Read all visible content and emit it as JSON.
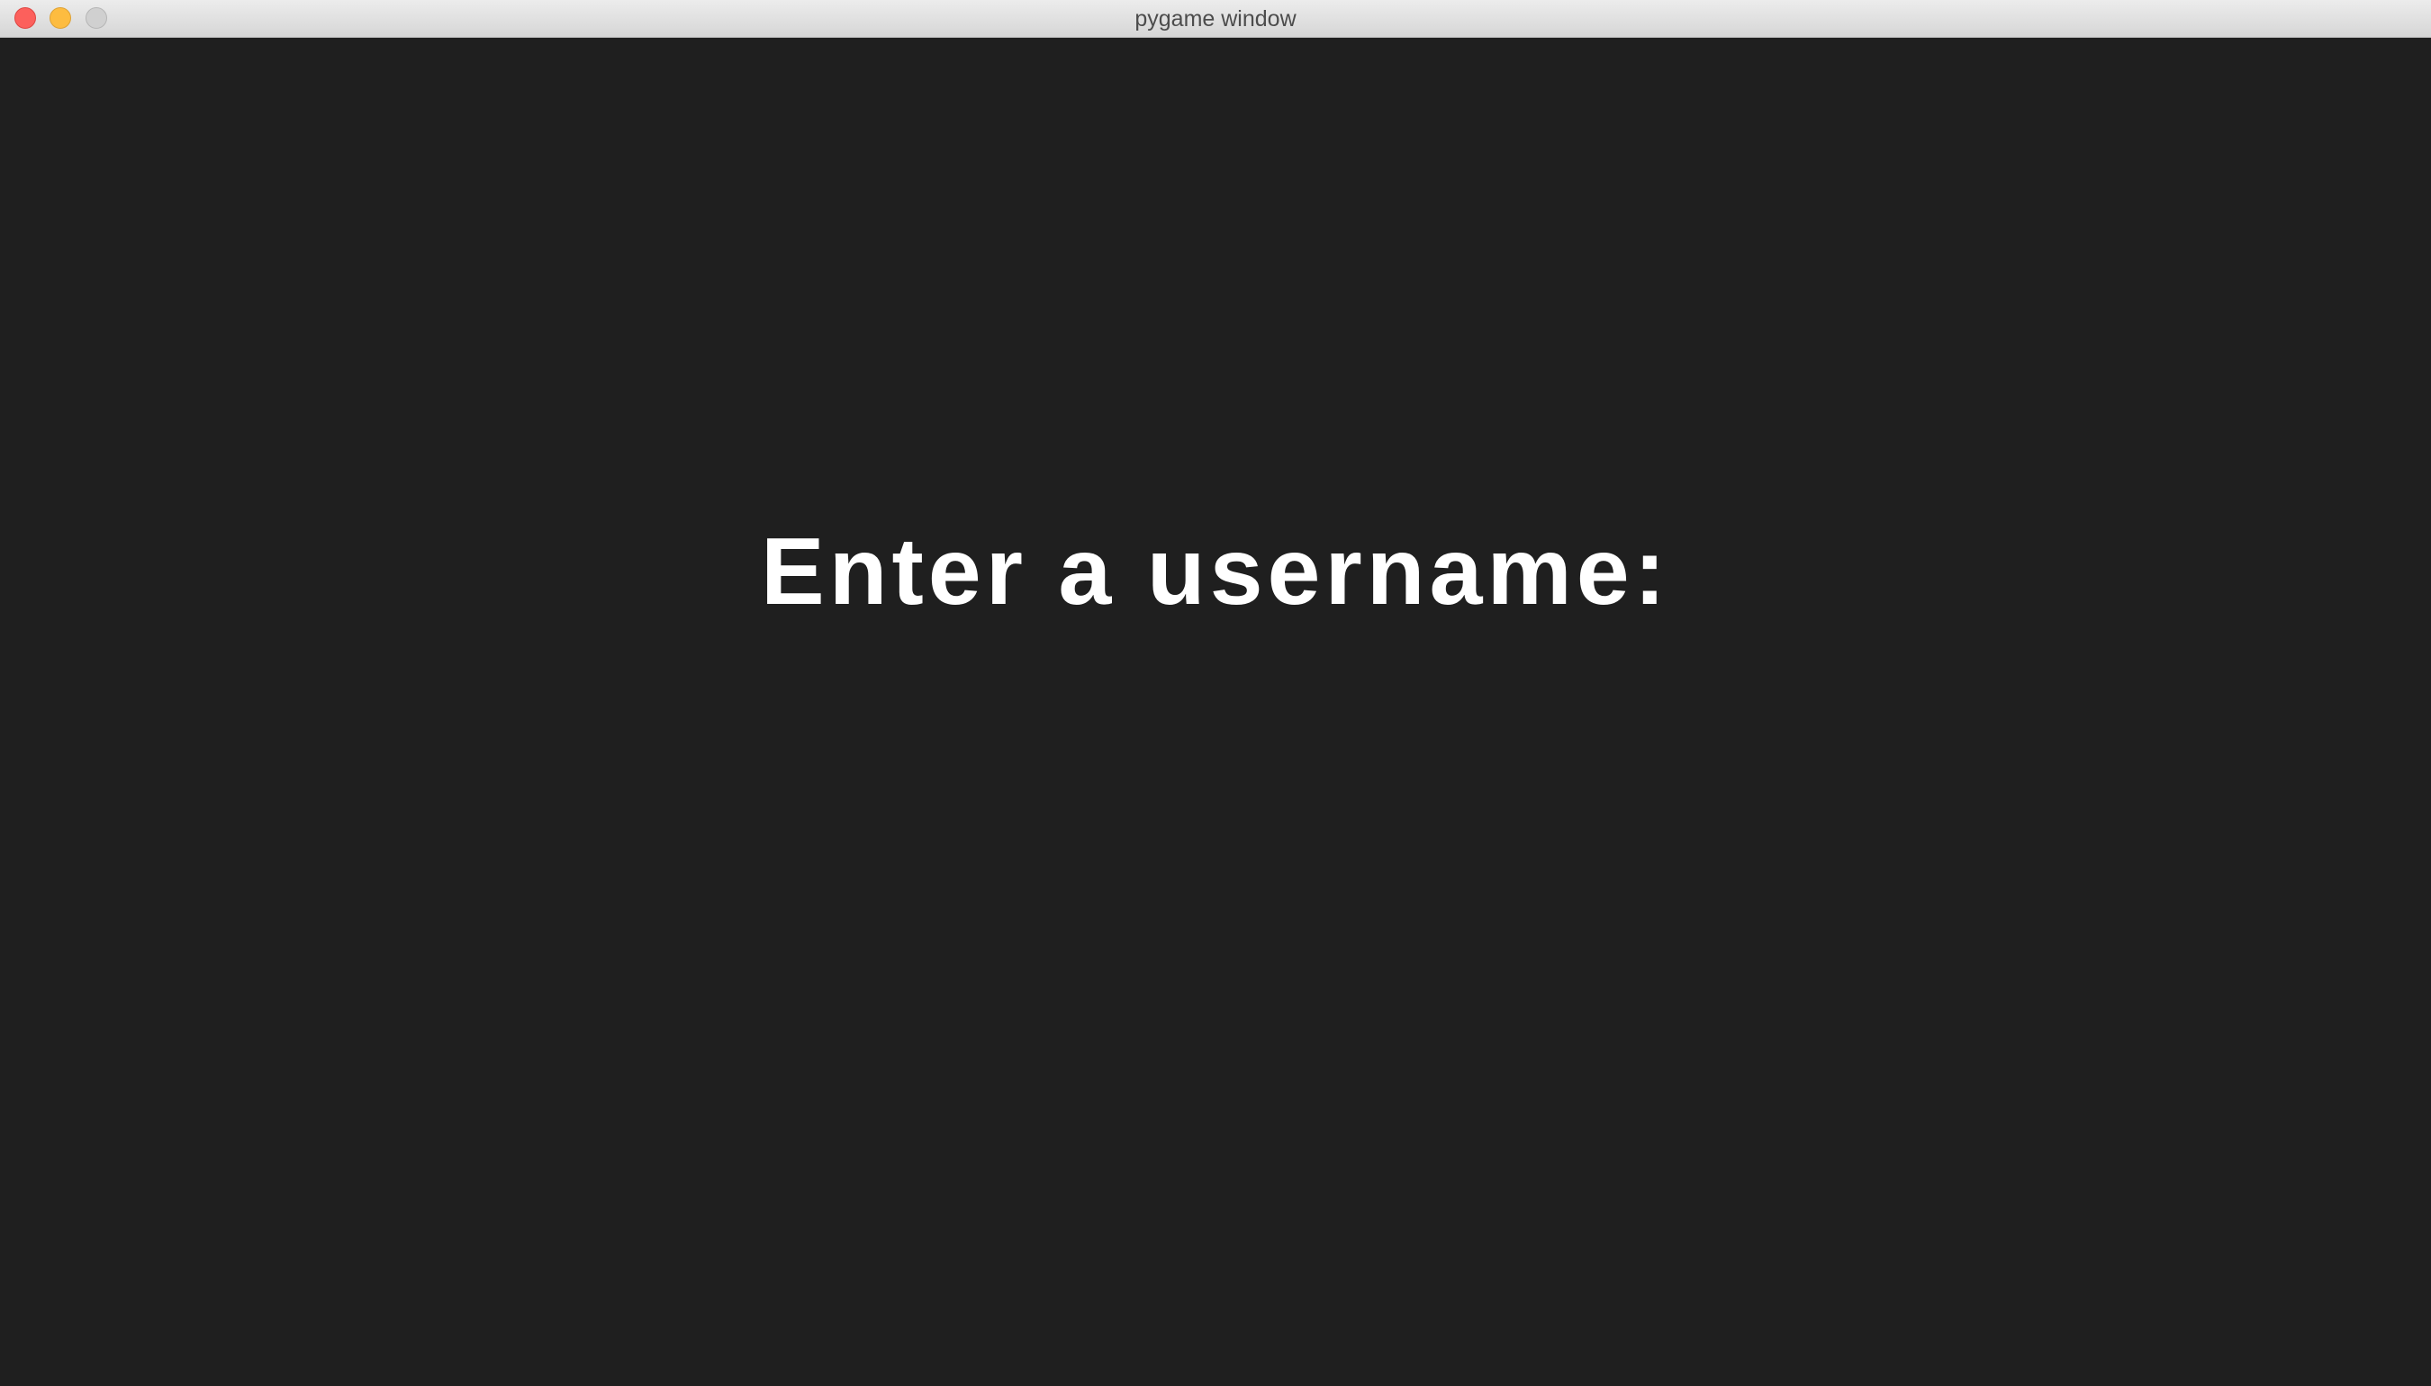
{
  "window": {
    "title": "pygame window"
  },
  "screen": {
    "prompt": "Enter a username:"
  },
  "colors": {
    "background": "#1f1f1f",
    "text": "#ffffff",
    "close": "#fc605c",
    "minimize": "#fdbc40",
    "zoom_disabled": "#d0d0d0"
  }
}
